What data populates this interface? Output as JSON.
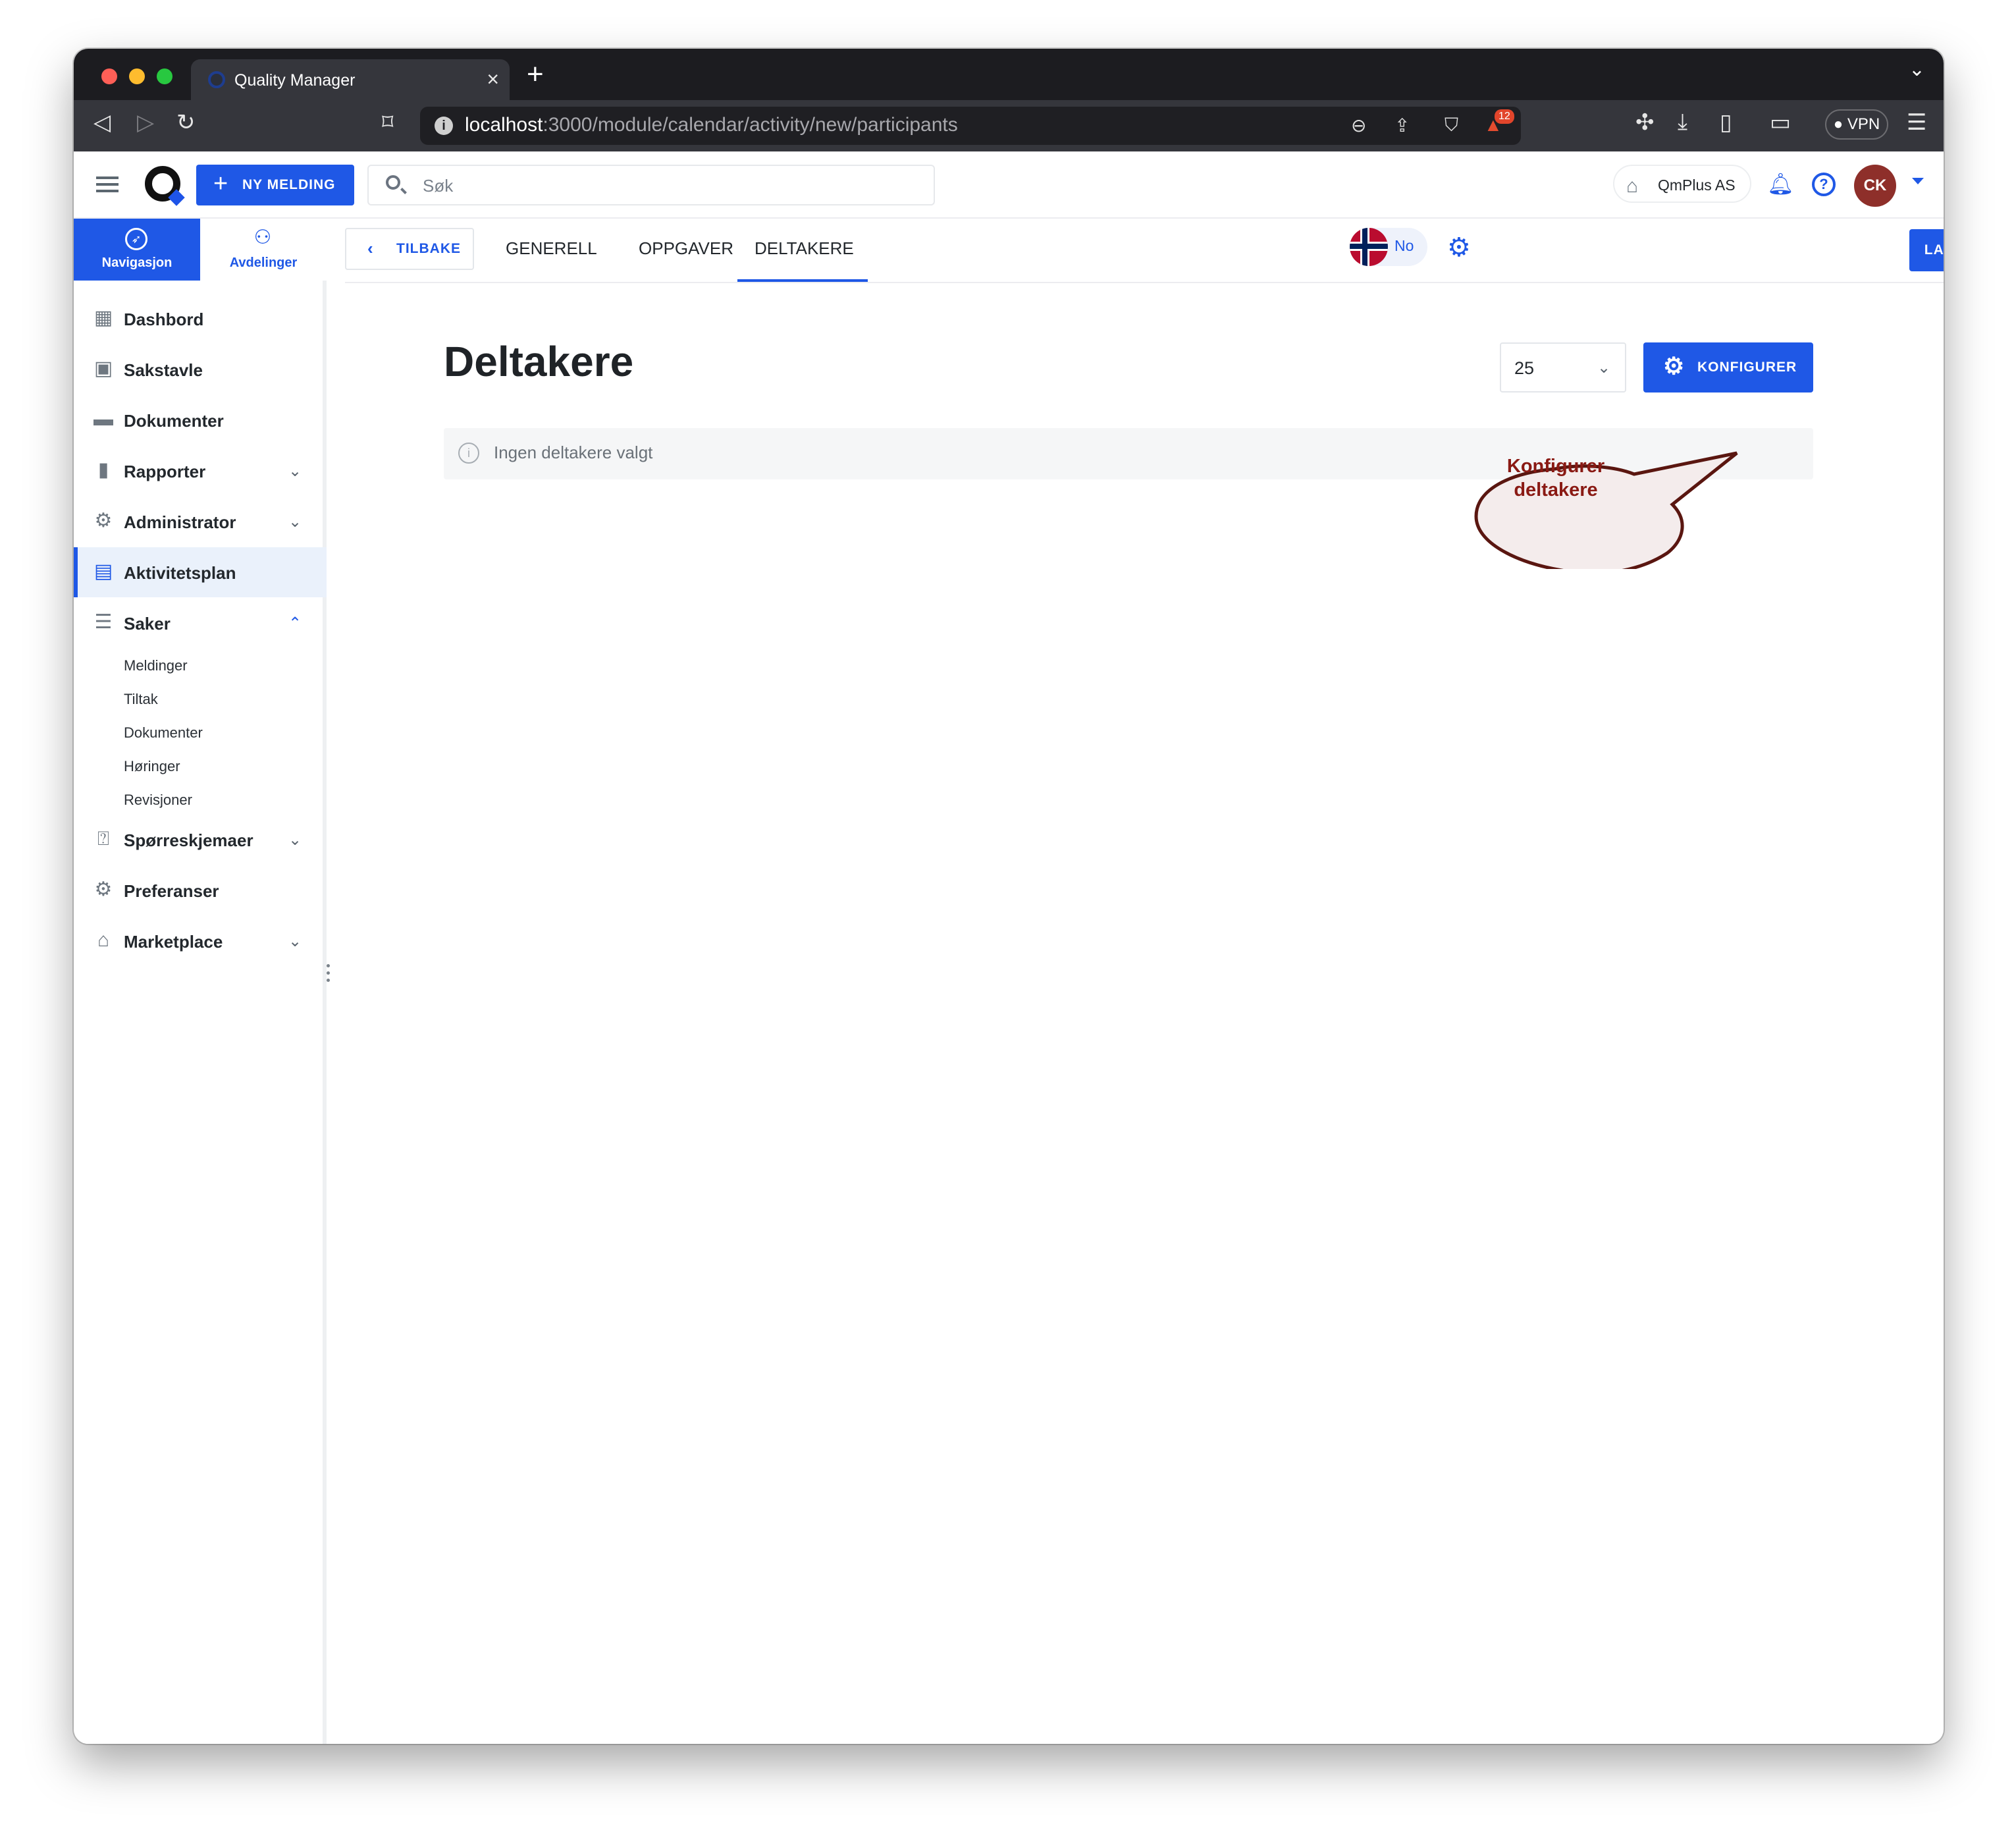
{
  "browser": {
    "tab_title": "Quality Manager",
    "url_host": "localhost",
    "url_path": ":3000/module/calendar/activity/new/participants",
    "shields_badge": "12",
    "vpn_label": "VPN"
  },
  "header": {
    "new_message_label": "NY MELDING",
    "search_placeholder": "Søk",
    "company_name": "QmPlus AS",
    "avatar_initials": "CK"
  },
  "sidebar": {
    "tabs": [
      {
        "label": "Navigasjon",
        "icon": "compass-icon",
        "active": true
      },
      {
        "label": "Avdelinger",
        "icon": "org-chart-icon",
        "active": false
      }
    ],
    "items": [
      {
        "label": "Dashbord",
        "icon": "dashboard-icon"
      },
      {
        "label": "Sakstavle",
        "icon": "board-icon"
      },
      {
        "label": "Dokumenter",
        "icon": "folder-icon"
      },
      {
        "label": "Rapporter",
        "icon": "bar-chart-icon",
        "expand": "collapsed"
      },
      {
        "label": "Administrator",
        "icon": "admin-gear-icon",
        "expand": "collapsed"
      },
      {
        "label": "Aktivitetsplan",
        "icon": "calendar-icon",
        "active": true
      },
      {
        "label": "Saker",
        "icon": "cases-icon",
        "expand": "expanded"
      },
      {
        "label": "Spørreskjemaer",
        "icon": "questionnaire-icon",
        "expand": "collapsed"
      },
      {
        "label": "Preferanser",
        "icon": "settings-icon"
      },
      {
        "label": "Marketplace",
        "icon": "store-icon",
        "expand": "collapsed"
      }
    ],
    "saker_subitems": [
      "Meldinger",
      "Tiltak",
      "Dokumenter",
      "Høringer",
      "Revisjoner"
    ]
  },
  "content": {
    "back_label": "TILBAKE",
    "tabs": [
      "GENERELL",
      "OPPGAVER",
      "DELTAKERE"
    ],
    "active_tab": "DELTAKERE",
    "language_label": "No",
    "save_label": "LAGRE",
    "page_title": "Deltakere",
    "page_size": "25",
    "configure_label": "KONFIGURER",
    "empty_message": "Ingen deltakere valgt",
    "callout_text": "Konfigurer deltakere"
  },
  "colors": {
    "primary": "#1f58e6",
    "avatar_bg": "#8e2f2a",
    "callout_fill": "#f4ecec",
    "callout_border": "#5a1610",
    "callout_text": "#8a1a14"
  }
}
